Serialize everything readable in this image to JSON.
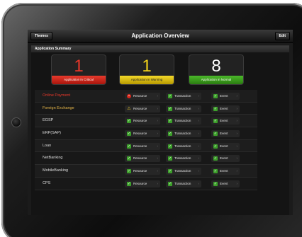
{
  "nav": {
    "title": "Application Overview",
    "themes_label": "Themes",
    "edit_label": "Edit"
  },
  "summary": {
    "header": "Application Summary",
    "cards": {
      "critical": {
        "count": "1",
        "label": "Application in Critical",
        "color": "#e8372a"
      },
      "warning": {
        "count": "1",
        "label": "Application in Warning",
        "color": "#f2d21a"
      },
      "normal": {
        "count": "8",
        "label": "Application in Normal",
        "color": "#4bb92a"
      }
    }
  },
  "columns": {
    "resource": "Resource",
    "transaction": "Transaction",
    "event": "Event"
  },
  "apps": [
    {
      "name": "Online Payment",
      "status": "critical",
      "resource_icon": "error-icon"
    },
    {
      "name": "Foreign Exchange",
      "status": "warning",
      "resource_icon": "warning-icon"
    },
    {
      "name": "EGSP",
      "status": "normal",
      "resource_icon": "ok-icon"
    },
    {
      "name": "ERP(SAP)",
      "status": "normal",
      "resource_icon": "ok-icon"
    },
    {
      "name": "Loan",
      "status": "normal",
      "resource_icon": "ok-icon"
    },
    {
      "name": "NetBanking",
      "status": "normal",
      "resource_icon": "ok-icon"
    },
    {
      "name": "MobileBanking",
      "status": "normal",
      "resource_icon": "ok-icon"
    },
    {
      "name": "CPS",
      "status": "normal",
      "resource_icon": "ok-icon"
    }
  ]
}
